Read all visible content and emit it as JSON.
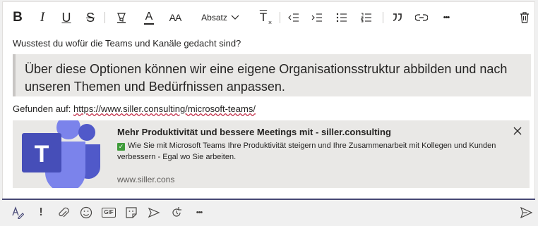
{
  "toolbar": {
    "bold": "B",
    "italic": "I",
    "underline": "U",
    "strikethrough": "S",
    "font_color": "A",
    "font_size": "AA",
    "paragraph_style": "Absatz",
    "clear_format": "T",
    "more": "•••"
  },
  "message": {
    "line1": "Wusstest du wofür die Teams und Kanäle gedacht sind?",
    "quote": "Über diese Optionen können wir eine eigene Organisationsstruktur abbilden und nach unseren Themen und Bedürfnissen anpassen.",
    "found_label": "Gefunden auf: ",
    "found_link": "https://www.siller.consulting/microsoft-teams/"
  },
  "link_preview": {
    "title": "Mehr Produktivität und bessere Meetings mit - siller.consulting",
    "description": "Wie Sie mit Microsoft Teams Ihre Produktivität steigern und Ihre Zusammenarbeit mit Kollegen und Kunden verbessern - Egal wo Sie arbeiten.",
    "url": "www.siller.cons",
    "image_letter": "T"
  },
  "compose_bar": {
    "important": "!",
    "gif": "GIF",
    "more": "•••"
  },
  "colors": {
    "accent": "#464775",
    "teams_dark": "#464eb8",
    "teams_light": "#7b83eb",
    "spellcheck": "#c4314b",
    "check_green": "#3f9b3a"
  },
  "icons": [
    "bold-icon",
    "italic-icon",
    "underline-icon",
    "strikethrough-icon",
    "highlight-icon",
    "font-color-icon",
    "font-size-icon",
    "chevron-down-icon",
    "clear-format-icon",
    "decrease-indent-icon",
    "increase-indent-icon",
    "bulleted-list-icon",
    "numbered-list-icon",
    "quote-icon",
    "link-icon",
    "more-icon",
    "trash-icon",
    "format-icon",
    "important-icon",
    "attach-icon",
    "emoji-icon",
    "gif-icon",
    "sticker-icon",
    "meet-now-icon",
    "loop-icon",
    "more-options-icon",
    "send-icon",
    "close-icon"
  ]
}
